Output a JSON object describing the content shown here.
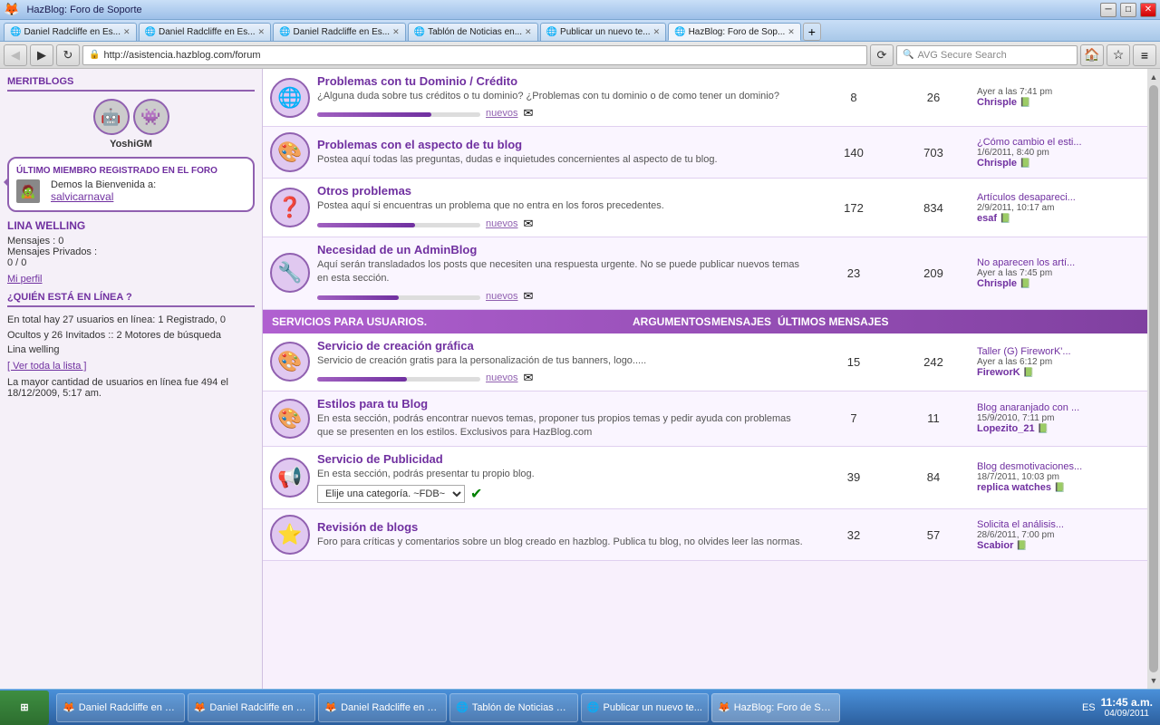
{
  "browser": {
    "title": "HazBlog: Foro de Soporte",
    "tabs": [
      {
        "label": "Daniel Radcliffe en Es...",
        "active": false,
        "icon": "🌐"
      },
      {
        "label": "Daniel Radcliffe en Es...",
        "active": false,
        "icon": "🌐"
      },
      {
        "label": "Daniel Radcliffe en Es...",
        "active": false,
        "icon": "🌐"
      },
      {
        "label": "Tablón de Noticias en...",
        "active": false,
        "icon": "🌐"
      },
      {
        "label": "Publicar un nuevo te...",
        "active": false,
        "icon": "🌐"
      },
      {
        "label": "HazBlog: Foro de Sop...",
        "active": true,
        "icon": "🌐"
      }
    ],
    "address": "http://asistencia.hazblog.com/forum",
    "search_placeholder": "AVG Secure Search"
  },
  "sidebar": {
    "meritblogs_title": "MERITBLOGS",
    "username": "YoshiGM",
    "last_member_title": "ÚLTIMO MIEMBRO REGISTRADO EN EL FORO",
    "last_member_text": "Demos la Bienvenida a:",
    "last_member_name": "salvicarnaval",
    "lina_welling_title": "LINA WELLING",
    "messages_label": "Mensajes :",
    "messages_value": "0",
    "private_messages_label": "Mensajes Privados :",
    "private_messages_value": "0 / 0",
    "my_profile": "Mi perfil",
    "who_online_title": "¿QUIÉN ESTÁ EN LÍNEA ?",
    "online_text": "En total hay 27 usuarios en línea: 1 Registrado, 0 Ocultos y 26 Invitados :: 2 Motores de búsqueda",
    "online_user": "Lina welling",
    "view_list": "[ Ver toda la lista ]",
    "max_text": "La mayor cantidad de usuarios en línea fue 494 el 18/12/2009, 5:17 am."
  },
  "sections": {
    "servicios_header": "SERVICIOS PARA USUARIOS.",
    "argumentos": "ARGUMENTOS",
    "mensajes": "MENSAJES",
    "ultimos_mensajes": "ÚLTIMOS MENSAJES"
  },
  "forum_rows_top": [
    {
      "title": "Problemas con tu Dominio / Crédito",
      "desc": "¿Alguna duda sobre tus créditos o tu dominio? ¿Problemas con tu dominio o de como tener un dominio?",
      "args": "8",
      "msgs": "26",
      "last_title": "Ayer a las 7:41 pm",
      "last_user": "Chrisple",
      "nuevos": "nuevos",
      "icon": "🌐"
    },
    {
      "title": "Problemas con el aspecto de tu blog",
      "desc": "Postea aquí todas las preguntas, dudas e inquietudes concernientes al aspecto de tu blog.",
      "args": "140",
      "msgs": "703",
      "last_title": "¿Cómo cambio el esti...",
      "last_date": "1/6/2011, 8:40 pm",
      "last_user": "Chrisple",
      "icon": "🎨"
    },
    {
      "title": "Otros problemas",
      "desc": "Postea aquí si encuentras un problema que no entra en los foros precedentes.",
      "args": "172",
      "msgs": "834",
      "last_title": "Artículos desapareci...",
      "last_date": "2/9/2011, 10:17 am",
      "last_user": "esaf",
      "nuevos": "nuevos",
      "icon": "❓"
    },
    {
      "title": "Necesidad de un AdminBlog",
      "desc": "Aquí serán transladados los posts que necesiten una respuesta urgente. No se puede publicar nuevos temas en esta sección.",
      "args": "23",
      "msgs": "209",
      "last_title": "No aparecen los artí...",
      "last_date": "Ayer a las 7:45 pm",
      "last_user": "Chrisple",
      "nuevos": "nuevos",
      "icon": "🔧"
    }
  ],
  "forum_rows_servicios": [
    {
      "title": "Servicio de creación gráfica",
      "desc": "Servicio de creación gratis para la personalización de tus banners, logo.....",
      "args": "15",
      "msgs": "242",
      "last_title": "Taller (G) FireworK'...",
      "last_date": "Ayer a las 6:12 pm",
      "last_user": "FireworK",
      "nuevos": "nuevos",
      "icon": "🎨"
    },
    {
      "title": "Estilos para tu Blog",
      "desc": "En esta sección, podrás encontrar nuevos temas, proponer tus propios temas y pedir ayuda con problemas que se presenten en los estilos. Exclusivos para HazBlog.com",
      "args": "7",
      "msgs": "11",
      "last_title": "Blog anaranjado con ...",
      "last_date": "15/9/2010, 7:11 pm",
      "last_user": "Lopezito_21",
      "icon": "🎨"
    },
    {
      "title": "Servicio de Publicidad",
      "desc": "En esta sección, podrás presentar tu propio blog.",
      "args": "39",
      "msgs": "84",
      "last_title": "Blog desmotivaciones...",
      "last_date": "18/7/2011, 10:03 pm",
      "last_user": "replica watches",
      "dropdown_label": "Elije una categoría. ~FDB~",
      "icon": "📢"
    },
    {
      "title": "Revisión de blogs",
      "desc": "Foro para críticas y comentarios sobre un blog creado en hazblog. Publica tu blog, no olvides leer las normas.",
      "args": "32",
      "msgs": "57",
      "last_title": "Solicita el análisis...",
      "last_date": "28/6/2011, 7:00 pm",
      "last_user": "Scabior",
      "icon": "⭐"
    }
  ],
  "taskbar": {
    "start_label": "start",
    "time": "11:45 a.m.",
    "date": "04/09/2011",
    "apps": [
      {
        "label": "Daniel Radcliffe en Es...",
        "icon": "🦊"
      },
      {
        "label": "Daniel Radcliffe en Es...",
        "icon": "🦊"
      },
      {
        "label": "Daniel Radcliffe en Es...",
        "icon": "🦊"
      },
      {
        "label": "Tablón de Noticias en...",
        "icon": "🦊"
      },
      {
        "label": "Publicar un nuevo te...",
        "icon": "🦊"
      },
      {
        "label": "HazBlog: Foro de Sop...",
        "icon": "🦊"
      }
    ]
  }
}
